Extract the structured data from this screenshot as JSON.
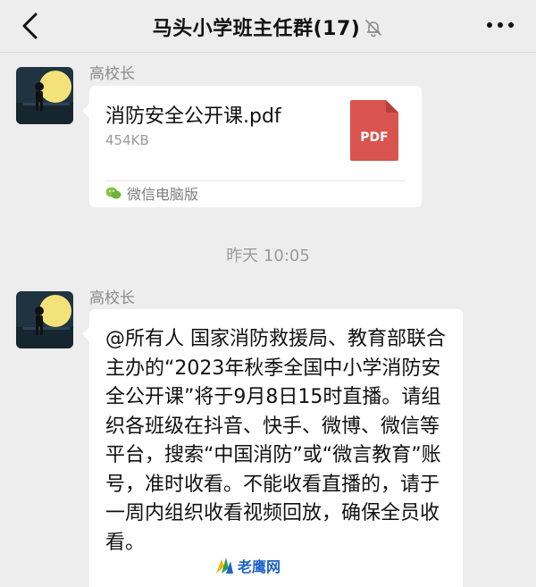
{
  "header": {
    "back_icon": "chevron-left-icon",
    "title": "马头小学班主任群(17)",
    "mute_icon": "bell-off-icon",
    "more_icon": "more-dots-icon"
  },
  "messages": [
    {
      "sender": "高校长",
      "type": "file",
      "file_name": "消防安全公开课.pdf",
      "file_size": "454KB",
      "file_icon_label": "PDF",
      "source": "微信电脑版"
    },
    {
      "time": "昨天 10:05"
    },
    {
      "sender": "高校长",
      "type": "text",
      "text": "@所有人 国家消防救援局、教育部联合主办的“2023年秋季全国中小学消防安全公开课”将于9月8日15时直播。请组织各班级在抖音、快手、微博、微信等平台，搜索“中国消防”或“微言教育”账号，准时收看。不能收看直播的，请于一周内组织收看视频回放，确保全员收看。"
    }
  ],
  "watermark": {
    "text": "老鹰网"
  },
  "colors": {
    "background": "#ededed",
    "bubble": "#ffffff",
    "pdf_red": "#d9534f",
    "meta_gray": "#9a9a9a"
  }
}
